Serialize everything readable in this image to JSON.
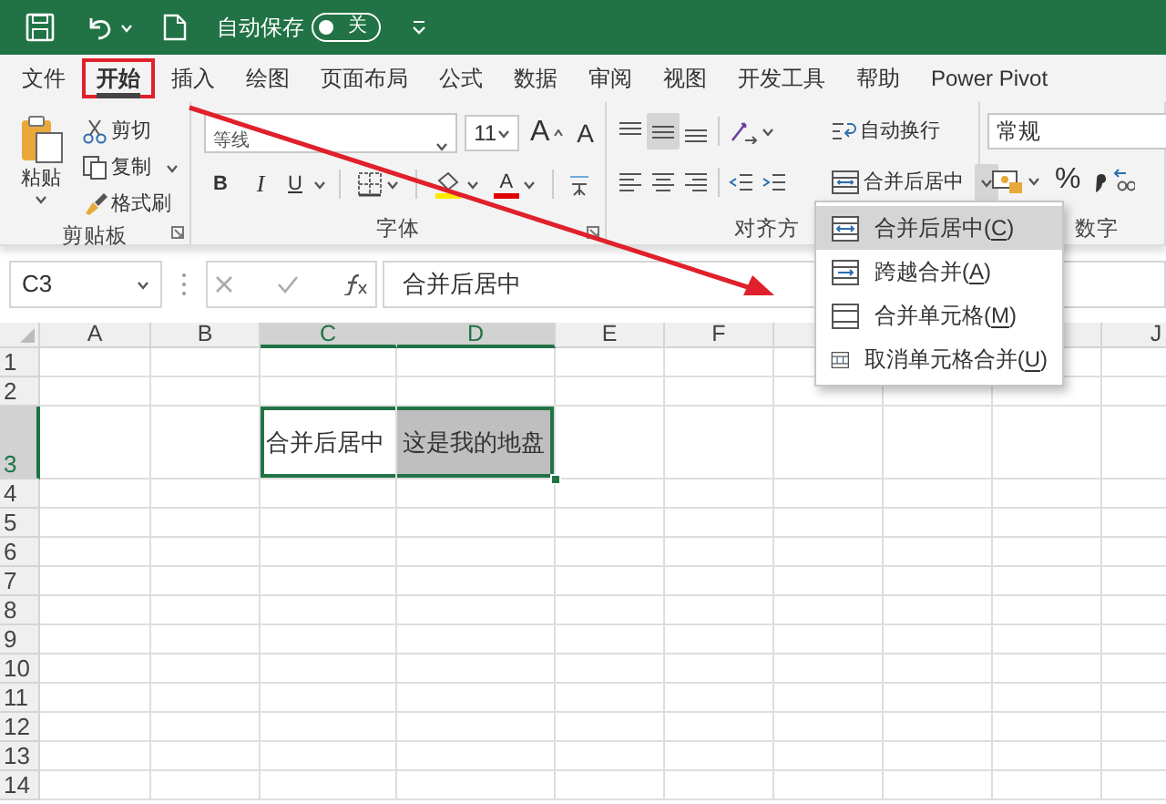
{
  "title_bar": {
    "autosave_label": "自动保存",
    "autosave_switch": {
      "label": "关",
      "on": false
    }
  },
  "tabs": [
    {
      "label": "文件",
      "selected": false,
      "annotated": false
    },
    {
      "label": "开始",
      "selected": true,
      "annotated": true
    },
    {
      "label": "插入",
      "selected": false,
      "annotated": false
    },
    {
      "label": "绘图",
      "selected": false,
      "annotated": false
    },
    {
      "label": "页面布局",
      "selected": false,
      "annotated": false
    },
    {
      "label": "公式",
      "selected": false,
      "annotated": false
    },
    {
      "label": "数据",
      "selected": false,
      "annotated": false
    },
    {
      "label": "审阅",
      "selected": false,
      "annotated": false
    },
    {
      "label": "视图",
      "selected": false,
      "annotated": false
    },
    {
      "label": "开发工具",
      "selected": false,
      "annotated": false
    },
    {
      "label": "帮助",
      "selected": false,
      "annotated": false
    },
    {
      "label": "Power Pivot",
      "selected": false,
      "annotated": false
    }
  ],
  "clipboard": {
    "paste": "粘贴",
    "cut": "剪切",
    "copy": "复制",
    "format_painter": "格式刷",
    "group_label": "剪贴板"
  },
  "font": {
    "font_name": "等线",
    "font_size": "11",
    "grow": "A",
    "shrink": "A",
    "bold": "B",
    "italic": "I",
    "underline": "U",
    "font_color": "A",
    "group_label": "字体"
  },
  "alignment": {
    "vertical_buttons": [
      {
        "kind": "top",
        "selected": false
      },
      {
        "kind": "middle",
        "selected": true
      },
      {
        "kind": "bottom",
        "selected": false
      }
    ],
    "horizontal_buttons": [
      {
        "kind": "left",
        "selected": false
      },
      {
        "kind": "center",
        "selected": false
      },
      {
        "kind": "right",
        "selected": false
      }
    ],
    "wrap_text": "自动换行",
    "merge_center": "合并后居中",
    "merge_dropdown_open": true,
    "group_label": "对齐方"
  },
  "number": {
    "format": "常规",
    "percent": "%",
    "group_label": "数字"
  },
  "formula_bar": {
    "name_box": "C3",
    "formula": "合并后居中"
  },
  "sheet": {
    "columns": [
      {
        "label": "A",
        "selected": false
      },
      {
        "label": "B",
        "selected": false
      },
      {
        "label": "C",
        "selected": true
      },
      {
        "label": "D",
        "selected": true
      },
      {
        "label": "E",
        "selected": false
      },
      {
        "label": "F",
        "selected": false
      },
      {},
      {},
      {},
      {
        "label": "J",
        "selected": false
      }
    ],
    "rows": [
      {
        "label": "1",
        "selected": false
      },
      {
        "label": "2",
        "selected": false
      },
      {
        "label": "3",
        "selected": true,
        "cells": [
          {},
          {},
          {
            "text": "合并后居中",
            "shaded": false
          },
          {
            "text": "这是我的地盘",
            "shaded": true
          }
        ]
      },
      {
        "label": "4",
        "selected": false
      },
      {
        "label": "5",
        "selected": false
      },
      {
        "label": "6",
        "selected": false
      },
      {
        "label": "7",
        "selected": false
      },
      {
        "label": "8",
        "selected": false
      },
      {
        "label": "9",
        "selected": false
      },
      {
        "label": "10",
        "selected": false
      },
      {
        "label": "11",
        "selected": false
      },
      {
        "label": "12",
        "selected": false
      },
      {
        "label": "13",
        "selected": false
      },
      {
        "label": "14",
        "selected": false
      }
    ]
  },
  "merge_menu": {
    "items": [
      {
        "kind": "merge_center",
        "label": "合并后居中(",
        "key": "C",
        "end": ")",
        "selected": true
      },
      {
        "kind": "merge_across",
        "label": "跨越合并(",
        "key": "A",
        "end": ")",
        "selected": false
      },
      {
        "kind": "merge_cells",
        "label": "合并单元格(",
        "key": "M",
        "end": ")",
        "selected": false
      },
      {
        "kind": "unmerge",
        "label": "取消单元格合并(",
        "key": "U",
        "end": ")",
        "selected": false
      }
    ]
  }
}
